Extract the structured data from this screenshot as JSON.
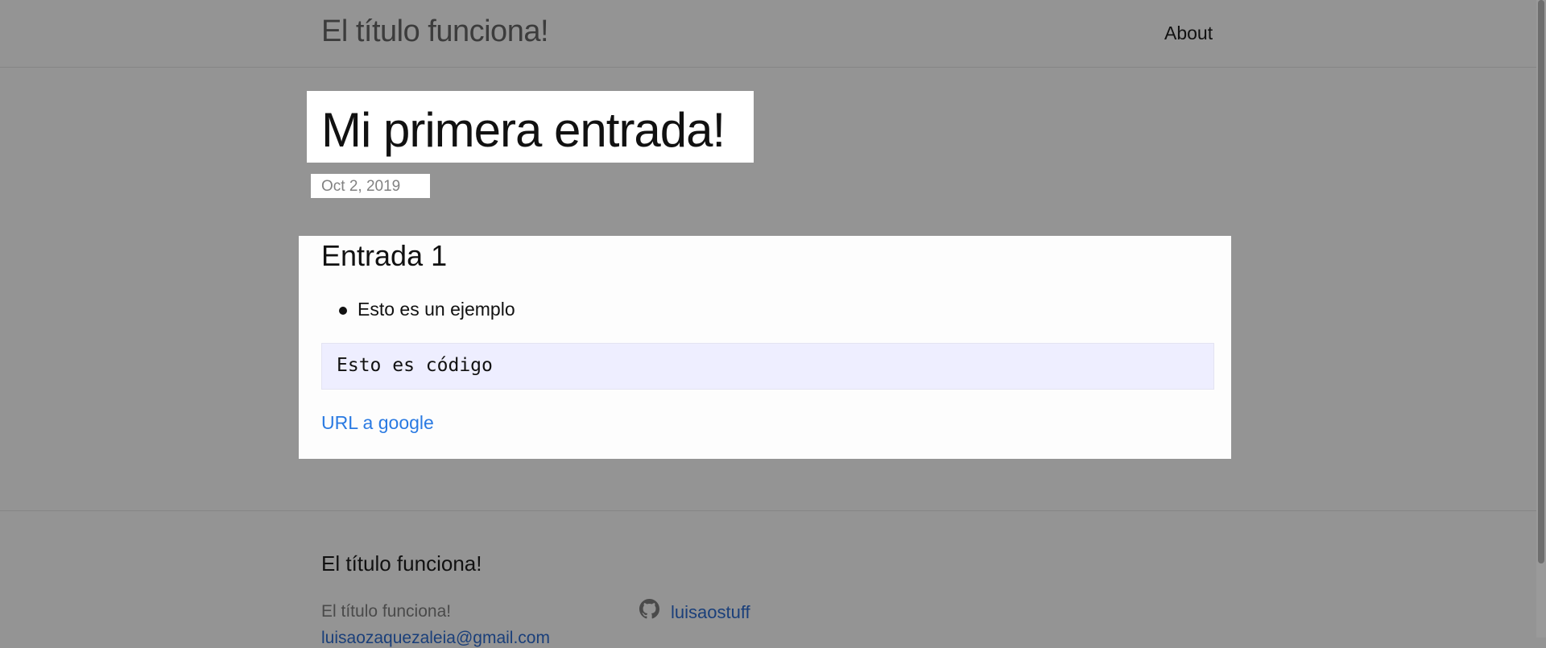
{
  "header": {
    "site_title": "El título funciona!",
    "nav": [
      "About"
    ]
  },
  "post": {
    "title": "Mi primera entrada!",
    "date": "Oct 2, 2019"
  },
  "content": {
    "heading": "Entrada 1",
    "list_items": [
      "Esto es un ejemplo"
    ],
    "code": "Esto es código",
    "link_text": "URL a google"
  },
  "footer": {
    "heading": "El título funciona!",
    "text": "El título funciona!",
    "email": "luisaozaquezaleia@gmail.com",
    "github_icon": "github-icon",
    "github_user": "luisaostuff"
  },
  "colors": {
    "overlay_background": "#949494",
    "card_background": "#fdfdfd",
    "link": "#2a7ae2",
    "code_background": "#eeeeff"
  }
}
